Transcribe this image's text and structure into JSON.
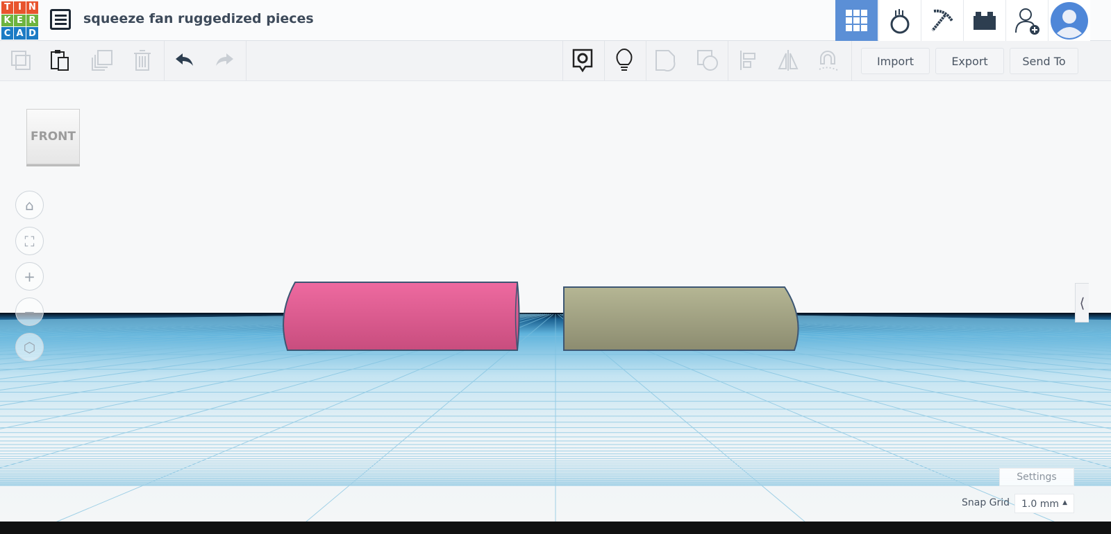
{
  "logo": {
    "letters": [
      "T",
      "I",
      "N",
      "K",
      "E",
      "R",
      "C",
      "A",
      "D"
    ],
    "colors": [
      "#e8542d",
      "#e8542d",
      "#e8542d",
      "#6eb43f",
      "#6eb43f",
      "#6eb43f",
      "#1b7bc4",
      "#1b7bc4",
      "#1b7bc4"
    ]
  },
  "header": {
    "title": "squeeze fan ruggedized pieces"
  },
  "toolbar": {
    "import_label": "Import",
    "export_label": "Export",
    "send_to_label": "Send To"
  },
  "viewcube": {
    "face": "FRONT"
  },
  "footer": {
    "settings_label": "Settings",
    "snap_grid_label": "Snap Grid",
    "snap_grid_value": "1.0 mm"
  },
  "shapes": [
    {
      "name": "pink-cylinder",
      "color": "#e85c94"
    },
    {
      "name": "olive-cylinder",
      "color": "#a8a98a"
    }
  ],
  "colors": {
    "accent": "#5b8fd6"
  }
}
